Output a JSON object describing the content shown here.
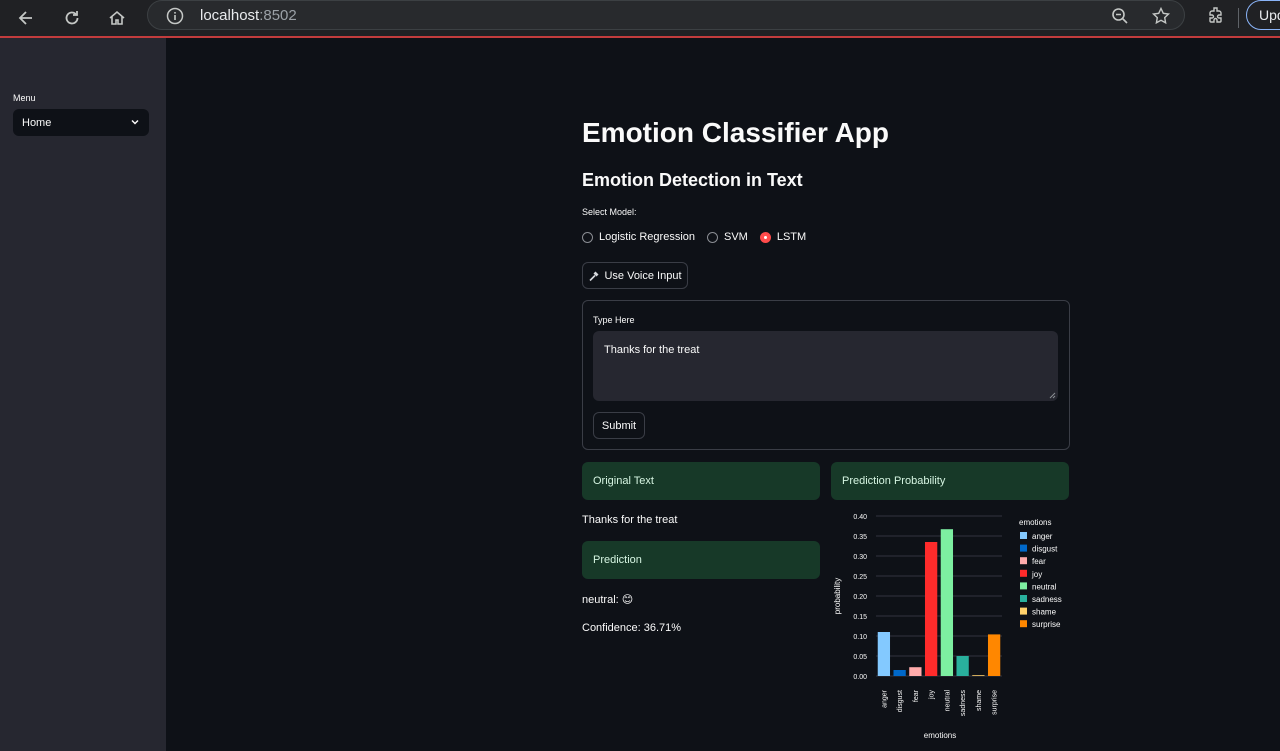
{
  "browser": {
    "url_host": "localhost",
    "url_port": ":8502",
    "update_label": "Upd"
  },
  "sidebar": {
    "menu_label": "Menu",
    "menu_value": "Home"
  },
  "main": {
    "title": "Emotion Classifier App",
    "subtitle": "Emotion Detection in Text",
    "model_label": "Select Model:",
    "models": [
      "Logistic Regression",
      "SVM",
      "LSTM"
    ],
    "selected_model": "LSTM",
    "voice_button": "Use Voice Input",
    "input_label": "Type Here",
    "input_value": "Thanks for the treat",
    "submit_label": "Submit",
    "original_header": "Original Text",
    "original_text": "Thanks for the treat",
    "prediction_header": "Prediction",
    "prediction_value": "neutral:",
    "prediction_emoji": "😊",
    "confidence": "Confidence: 36.71%",
    "probability_header": "Prediction Probability"
  },
  "colors": {
    "accent": "#ff4b4b",
    "panel_bg": "#173928"
  },
  "chart_data": {
    "type": "bar",
    "xlabel": "emotions",
    "ylabel": "probability",
    "ylim": [
      0,
      0.4
    ],
    "yticks": [
      "0.00",
      "0.05",
      "0.10",
      "0.15",
      "0.20",
      "0.25",
      "0.30",
      "0.35",
      "0.40"
    ],
    "legend_title": "emotions",
    "legend_placement": "right",
    "categories": [
      "anger",
      "disgust",
      "fear",
      "joy",
      "neutral",
      "sadness",
      "shame",
      "surprise"
    ],
    "values": [
      0.11,
      0.015,
      0.022,
      0.335,
      0.367,
      0.05,
      0.002,
      0.104
    ],
    "colors": [
      "#83c9ff",
      "#0068c9",
      "#ffabab",
      "#ff2b2b",
      "#7defa1",
      "#29b09d",
      "#ffd16a",
      "#ff8700"
    ]
  }
}
